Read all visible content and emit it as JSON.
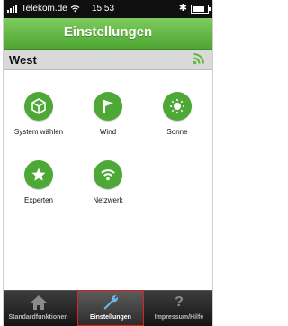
{
  "status_bar": {
    "carrier": "Telekom.de",
    "time": "15:53"
  },
  "nav": {
    "title": "Einstellungen"
  },
  "location": {
    "name": "West"
  },
  "grid": [
    {
      "label": "System wählen",
      "icon": "cube-icon"
    },
    {
      "label": "Wind",
      "icon": "flag-icon"
    },
    {
      "label": "Sonne",
      "icon": "sun-icon"
    },
    {
      "label": "Experten",
      "icon": "star-icon"
    },
    {
      "label": "Netzwerk",
      "icon": "wifi-icon"
    }
  ],
  "tabs": [
    {
      "label": "Standardfunktionen",
      "icon": "home-icon",
      "active": false
    },
    {
      "label": "Einstellungen",
      "icon": "wrench-icon",
      "active": true
    },
    {
      "label": "Impressum/Hilfe",
      "icon": "help-icon",
      "active": false
    }
  ],
  "colors": {
    "accent": "#4ea836",
    "tabbar": "#1f1f1f",
    "active_outline": "#dd2222"
  }
}
